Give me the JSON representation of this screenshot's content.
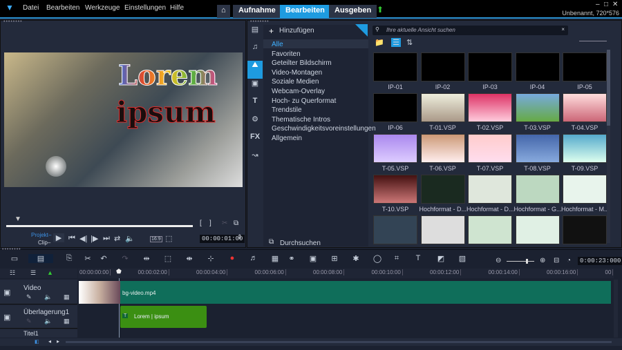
{
  "menu": {
    "items": [
      "Datei",
      "Bearbeiten",
      "Werkzeuge",
      "Einstellungen",
      "Hilfe"
    ]
  },
  "tabs": [
    {
      "label": "Aufnahme"
    },
    {
      "label": "Bearbeiten",
      "active": true
    },
    {
      "label": "Ausgeben"
    }
  ],
  "project_info": "Unbenannt, 720*576",
  "preview": {
    "title_line1": "Lorem",
    "title_line2": "ipsum",
    "mode_project": "Projekt–",
    "mode_clip": "Clip–",
    "timecode": "00:00:01:00",
    "aspect": "16:9"
  },
  "library": {
    "add_label": "Hinzufügen",
    "search_placeholder": "Ihre aktuelle Ansicht suchen",
    "browse_label": "Durchsuchen",
    "categories": [
      "Alle",
      "Favoriten",
      "Geteilter Bildschirm",
      "Video-Montagen",
      "Soziale Medien",
      "Webcam-Overlay",
      "Hoch- zu Querformat",
      "Trendstile",
      "Thematische Intros",
      "Geschwindigkeitsvoreinstellungen",
      "Allgemein"
    ],
    "items": [
      "IP-01",
      "IP-02",
      "IP-03",
      "IP-04",
      "IP-05",
      "IP-06",
      "T-01.VSP",
      "T-02.VSP",
      "T-03.VSP",
      "T-04.VSP",
      "T-05.VSP",
      "T-06.VSP",
      "T-07.VSP",
      "T-08.VSP",
      "T-09.VSP",
      "T-10.VSP",
      "Hochformat - D...",
      "Hochformat - D...",
      "Hochformat - G...",
      "Hochformat - M...",
      "",
      "",
      "",
      "",
      ""
    ]
  },
  "timeline": {
    "duration": "0:00:23:000",
    "ruler": [
      "00:00:00:00",
      "00:00:02:00",
      "00:00:04:00",
      "00:00:06:00",
      "00:00:08:00",
      "00:00:10:00",
      "00:00:12:00",
      "00:00:14:00",
      "00:00:16:00",
      "00"
    ],
    "tracks": [
      {
        "name": "Video",
        "clip": "bg-video.mp4"
      },
      {
        "name": "Überlagerung1",
        "clip": "Lorem | ipsum"
      },
      {
        "name": "Titel1"
      }
    ]
  },
  "colors": {
    "accent": "#1e9be0",
    "video_clip": "#0f6e5a",
    "title_clip": "#3b8f12"
  }
}
